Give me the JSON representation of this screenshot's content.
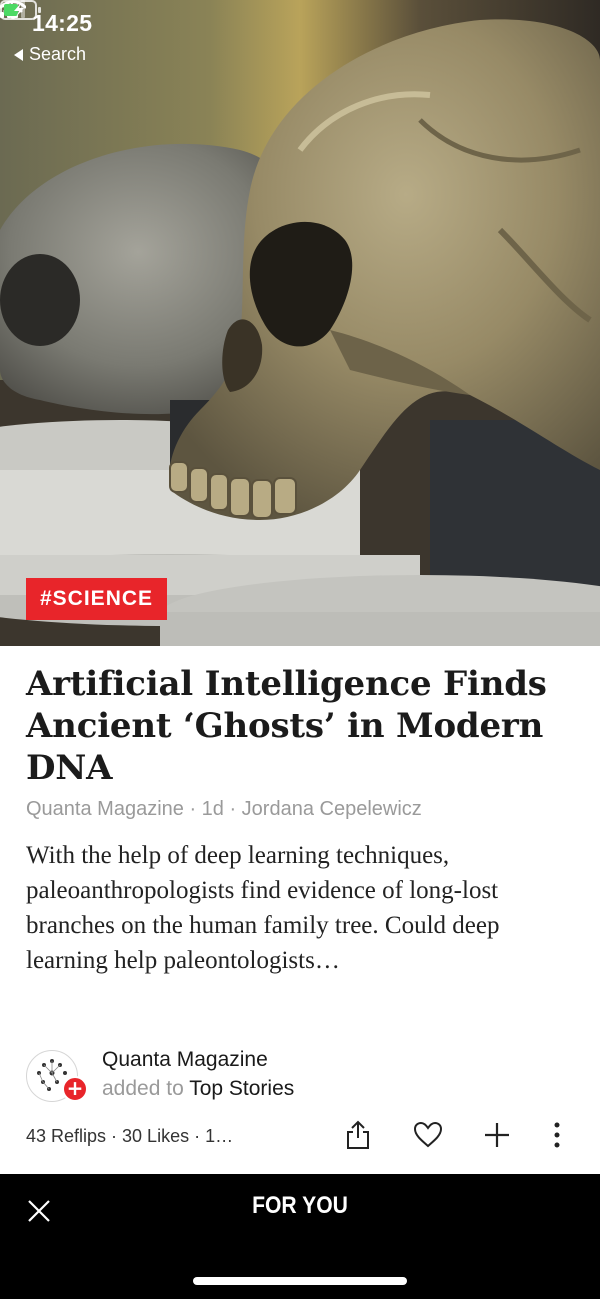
{
  "status_bar": {
    "time": "14:25",
    "back_label": "Search"
  },
  "hero": {
    "image_subject": "skull",
    "category_tag": "#SCIENCE"
  },
  "article": {
    "headline": "Artificial Intelligence Finds Ancient ‘Ghosts’ in Modern DNA",
    "byline": "Quanta Magazine · 1d · Jordana Cepelewicz",
    "excerpt": "With the help of deep learning techniques, paleoanthropologists find evidence of long-lost branches on the human family tree. Could deep learning help paleontologists…"
  },
  "attribution": {
    "source_name": "Quanta Magazine",
    "added_text": "added to",
    "added_target": "Top Stories"
  },
  "actions": {
    "stats": "43 Reflips · 30 Likes · 1…",
    "icons": [
      "share-icon",
      "heart-icon",
      "plus-icon",
      "more-icon"
    ]
  },
  "bottom_bar": {
    "title": "FOR YOU"
  },
  "colors": {
    "accent_red": "#e8252a",
    "bottom_bar": "#000000",
    "meta_gray": "#9a9a9a"
  }
}
